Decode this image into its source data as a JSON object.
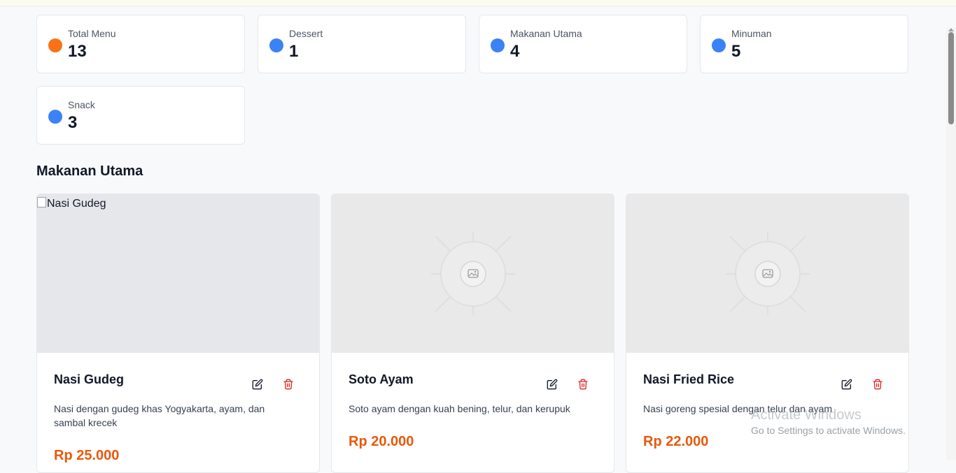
{
  "stats": [
    {
      "label": "Total Menu",
      "value": "13",
      "color": "#f97316"
    },
    {
      "label": "Dessert",
      "value": "1",
      "color": "#3b82f6"
    },
    {
      "label": "Makanan Utama",
      "value": "4",
      "color": "#3b82f6"
    },
    {
      "label": "Minuman",
      "value": "5",
      "color": "#3b82f6"
    },
    {
      "label": "Snack",
      "value": "3",
      "color": "#3b82f6"
    }
  ],
  "section": {
    "title": "Makanan Utama"
  },
  "menu_items": [
    {
      "name": "Nasi Gudeg",
      "image_alt": "Nasi Gudeg",
      "description": "Nasi dengan gudeg khas Yogyakarta, ayam, dan sambal krecek",
      "price": "Rp 25.000",
      "edit_icon": "edit-icon",
      "delete_icon": "trash-icon"
    },
    {
      "name": "Soto Ayam",
      "image_alt": "",
      "description": "Soto ayam dengan kuah bening, telur, dan kerupuk",
      "price": "Rp 20.000",
      "edit_icon": "edit-icon",
      "delete_icon": "trash-icon"
    },
    {
      "name": "Nasi Fried Rice",
      "image_alt": "",
      "description": "Nasi goreng spesial dengan telur dan ayam",
      "price": "Rp 22.000",
      "edit_icon": "edit-icon",
      "delete_icon": "trash-icon"
    }
  ],
  "watermark": {
    "title": "Activate Windows",
    "subtitle": "Go to Settings to activate Windows."
  },
  "colors": {
    "accent": "#e8590c",
    "delete": "#dc2626",
    "dot_orange": "#f97316",
    "dot_blue": "#3b82f6"
  }
}
